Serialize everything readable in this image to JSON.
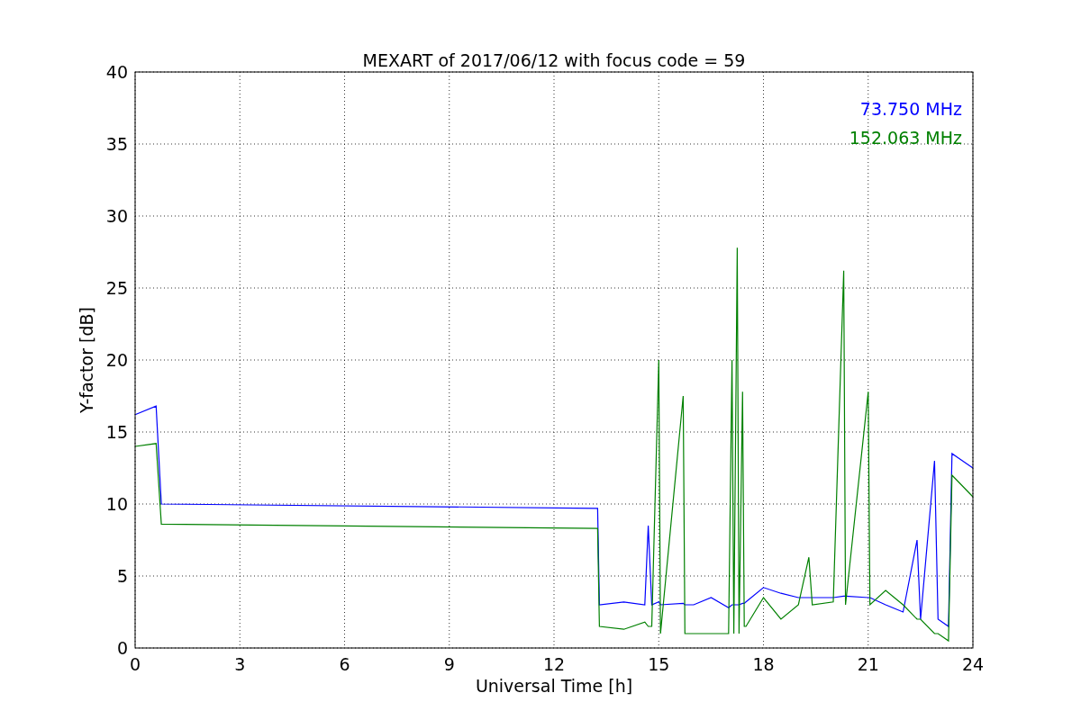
{
  "chart_data": {
    "type": "line",
    "title": "MEXART of 2017/06/12 with focus code = 59",
    "xlabel": "Universal Time [h]",
    "ylabel": "Y-factor [dB]",
    "xlim": [
      0,
      24
    ],
    "ylim": [
      0,
      40
    ],
    "xticks": [
      0,
      3,
      6,
      9,
      12,
      15,
      18,
      21,
      24
    ],
    "yticks": [
      0,
      5,
      10,
      15,
      20,
      25,
      30,
      35,
      40
    ],
    "grid": true,
    "x": [
      0,
      0.6,
      0.75,
      13.25,
      13.3,
      14,
      14.6,
      14.7,
      14.8,
      15,
      15.05,
      15.7,
      15.75,
      16,
      16.5,
      17,
      17.1,
      17.15,
      17.25,
      17.3,
      17.4,
      17.45,
      17.5,
      18,
      18.5,
      19,
      19.3,
      19.4,
      20,
      20.3,
      20.35,
      21,
      21.05,
      21.5,
      22,
      22.4,
      22.5,
      22.9,
      23,
      23.3,
      23.4,
      24
    ],
    "series": [
      {
        "name": "73.750 MHz",
        "color": "#0000ff",
        "values": [
          16.2,
          16.8,
          10.0,
          9.7,
          3.0,
          3.2,
          3.0,
          8.5,
          3.0,
          3.2,
          3.0,
          3.1,
          3.0,
          3.0,
          3.5,
          2.8,
          3.0,
          3.0,
          3.0,
          3.0,
          3.1,
          3.1,
          3.2,
          4.2,
          3.8,
          3.5,
          3.5,
          3.5,
          3.5,
          3.6,
          3.6,
          3.5,
          3.5,
          3.0,
          2.5,
          7.5,
          2.0,
          13.0,
          2.0,
          1.5,
          13.5,
          12.5
        ]
      },
      {
        "name": "152.063 MHz",
        "color": "#008000",
        "values": [
          14.0,
          14.2,
          8.6,
          8.3,
          1.5,
          1.3,
          1.8,
          1.5,
          1.5,
          20.0,
          1.0,
          17.5,
          1.0,
          1.0,
          1.0,
          1.0,
          20.0,
          1.0,
          27.8,
          1.0,
          17.8,
          1.5,
          1.5,
          3.5,
          2.0,
          3.0,
          6.3,
          3.0,
          3.2,
          26.2,
          3.0,
          17.8,
          3.0,
          4.0,
          3.0,
          2.0,
          2.0,
          1.0,
          1.0,
          0.5,
          12.0,
          10.5
        ]
      }
    ]
  }
}
